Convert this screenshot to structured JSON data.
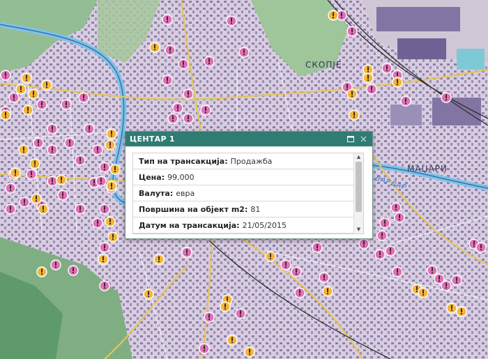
{
  "map": {
    "place_labels": [
      "СКОПЈЕ",
      "МАЏАРИ"
    ],
    "river_label": "ВАРДАР",
    "colors": {
      "sale_marker": "#e070b8",
      "rent_marker": "#f2b63a",
      "urban": "#d8cde0",
      "terrain": "#8fb98f",
      "river": "#7ec3e6"
    }
  },
  "popup": {
    "title": "ЦЕНТАР 1",
    "maximize_icon": "window-maximize-icon",
    "close_icon": "close-icon",
    "fields": [
      {
        "label": "Тип на трансакција:",
        "value": "Продажба"
      },
      {
        "label": "Цена:",
        "value": "99,000"
      },
      {
        "label": "Валута:",
        "value": "евра"
      },
      {
        "label": "Површина на објект m2:",
        "value": "81"
      },
      {
        "label": "Датум на трансакција:",
        "value": "21/05/2015"
      }
    ]
  }
}
